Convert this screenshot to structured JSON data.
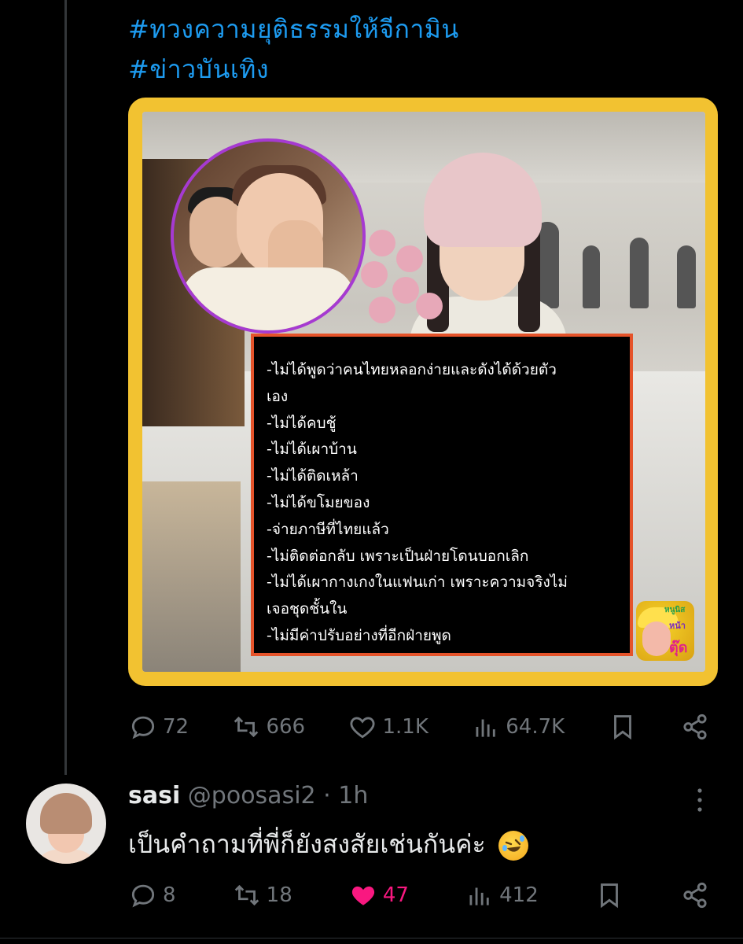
{
  "post": {
    "hashtags": [
      "#ทวงความยุติธรรมให้จีกามิน",
      "#ข่าวบันเทิง"
    ],
    "caption_lines": [
      "-ไม่ได้พูดว่าคนไทยหลอกง่ายและดังได้ด้วยตัว",
      "เอง",
      "-ไม่ได้คบชู้",
      "-ไม่ได้เผาบ้าน",
      "-ไม่ได้ติดเหล้า",
      "-ไม่ได้ขโมยของ",
      "-จ่ายภาษีที่ไทยแล้ว",
      "-ไม่ติดต่อกลับ เพราะเป็นฝ่ายโดนบอกเลิก",
      "-ไม่ได้เผากางเกงในแฟนเก่า เพราะความจริงไม่",
      "เจอชุดชั้นใน",
      "-ไม่มีค่าปรับอย่างที่อีกฝ่ายพูด"
    ],
    "logo": {
      "line1": "หนูนิส",
      "line2": "หน้า",
      "line3": "ตุ๊ด"
    },
    "stats": {
      "replies": "72",
      "reposts": "666",
      "likes": "1.1K",
      "views": "64.7K"
    }
  },
  "reply": {
    "name": "sasi",
    "handle": "@poosasi2",
    "time": "1h",
    "separator": "·",
    "text": "เป็นคำถามที่พี่ก็ยังสงสัยเช่นกันค่ะ",
    "emoji": "rolling-on-floor-laughing",
    "stats": {
      "replies": "8",
      "reposts": "18",
      "likes": "47",
      "views": "412"
    },
    "liked": true
  },
  "colors": {
    "background": "#000000",
    "hashtag": "#1d9bf0",
    "muted": "#71767b",
    "like_active": "#f91880",
    "media_frame": "#f2c231",
    "caption_border": "#e5532a",
    "inset_border": "#a63ad1"
  }
}
